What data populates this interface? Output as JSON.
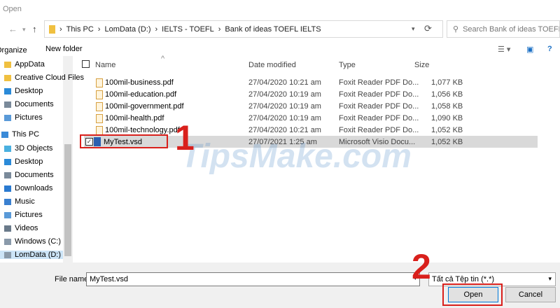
{
  "window": {
    "title": "Open"
  },
  "address": {
    "crumbs": [
      "This PC",
      "LomData (D:)",
      "IELTS - TOEFL",
      "Bank of ideas TOEFL IELTS"
    ],
    "search_placeholder": "Search Bank of ideas TOEFL IELTS"
  },
  "toolbar": {
    "organize": "Organize",
    "new_folder": "New folder"
  },
  "sidebar": {
    "items": [
      {
        "label": "AppData",
        "icon": "folder-icon"
      },
      {
        "label": "Creative Cloud Files",
        "icon": "folder-icon"
      },
      {
        "label": "Desktop",
        "icon": "desktop-icon"
      },
      {
        "label": "Documents",
        "icon": "documents-icon"
      },
      {
        "label": "Pictures",
        "icon": "pictures-icon"
      },
      {
        "label": "This PC",
        "icon": "computer-icon"
      },
      {
        "label": "3D Objects",
        "icon": "3d-icon"
      },
      {
        "label": "Desktop",
        "icon": "desktop-icon"
      },
      {
        "label": "Documents",
        "icon": "documents-icon"
      },
      {
        "label": "Downloads",
        "icon": "downloads-icon"
      },
      {
        "label": "Music",
        "icon": "music-icon"
      },
      {
        "label": "Pictures",
        "icon": "pictures-icon"
      },
      {
        "label": "Videos",
        "icon": "videos-icon"
      },
      {
        "label": "Windows (C:)",
        "icon": "drive-icon"
      },
      {
        "label": "LomData (D:)",
        "icon": "drive-icon"
      }
    ]
  },
  "columns": {
    "name": "Name",
    "date": "Date modified",
    "type": "Type",
    "size": "Size"
  },
  "files": [
    {
      "name": "100mil-business.pdf",
      "date": "27/04/2020 10:21 am",
      "type": "Foxit Reader PDF Do...",
      "size": "1,077 KB"
    },
    {
      "name": "100mil-education.pdf",
      "date": "27/04/2020 10:19 am",
      "type": "Foxit Reader PDF Do...",
      "size": "1,056 KB"
    },
    {
      "name": "100mil-government.pdf",
      "date": "27/04/2020 10:19 am",
      "type": "Foxit Reader PDF Do...",
      "size": "1,058 KB"
    },
    {
      "name": "100mil-health.pdf",
      "date": "27/04/2020 10:19 am",
      "type": "Foxit Reader PDF Do...",
      "size": "1,090 KB"
    },
    {
      "name": "100mil-technology.pdf",
      "date": "27/04/2020 10:21 am",
      "type": "Foxit Reader PDF Do...",
      "size": "1,052 KB"
    },
    {
      "name": "MyTest.vsd",
      "date": "27/07/2021 1:25 am",
      "type": "Microsoft Visio Docu...",
      "size": "1,052 KB"
    }
  ],
  "bottom": {
    "file_name_label": "File name:",
    "file_name_value": "MyTest.vsd",
    "file_type": "Tất cả Tệp tin (*.*)",
    "open": "Open",
    "cancel": "Cancel"
  },
  "annotations": {
    "step1": "1",
    "step2": "2",
    "watermark": "TipsMake.com"
  }
}
